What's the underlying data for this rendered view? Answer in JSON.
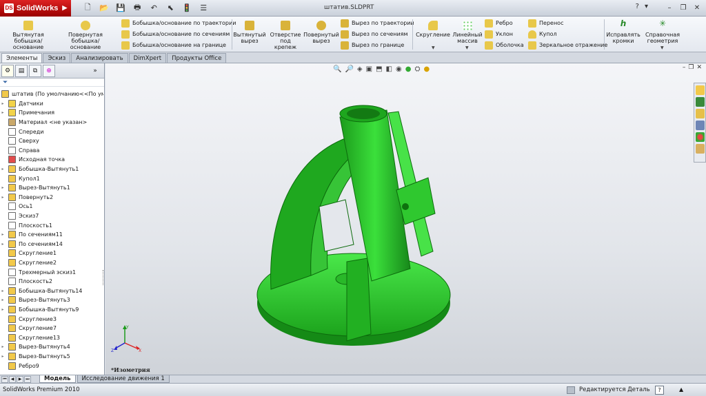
{
  "app": {
    "logo": "SolidWorks",
    "document_title": "штатив.SLDPRT",
    "quick": [
      {
        "name": "new-icon",
        "glyph": "🗋"
      },
      {
        "name": "open-icon",
        "glyph": "📂"
      },
      {
        "name": "save-icon",
        "glyph": "💾"
      },
      {
        "name": "print-icon",
        "glyph": "🖶"
      },
      {
        "name": "undo-icon",
        "glyph": "↶"
      },
      {
        "name": "select-icon",
        "glyph": "⬉"
      },
      {
        "name": "rebuild-icon",
        "glyph": "🚦"
      },
      {
        "name": "options-icon",
        "glyph": "☰"
      }
    ]
  },
  "commands": {
    "extruded_boss": "Вытянутая бобышка/основание",
    "revolved_boss": "Повернутая бобышка/основание",
    "swept_boss": "Бобышка/основание по траектории",
    "lofted_boss": "Бобышка/основание по сечениям",
    "boundary_boss": "Бобышка/основание на границе",
    "extruded_cut": "Вытянутый вырез",
    "hole_wizard": "Отверстие под крепеж",
    "revolved_cut": "Повернутый вырез",
    "swept_cut": "Вырез по траектории",
    "lofted_cut": "Вырез по сечениям",
    "boundary_cut": "Вырез по границе",
    "fillet": "Скругление",
    "linear_pattern": "Линейный массив",
    "rib": "Ребро",
    "draft": "Уклон",
    "shell": "Оболочка",
    "wrap": "Перенос",
    "dome": "Купол",
    "mirror": "Зеркальное отражение",
    "instant3d": "Исправлять кромки",
    "ref_geometry": "Справочная геометрия"
  },
  "cmd_tabs": [
    "Элементы",
    "Эскиз",
    "Анализировать",
    "DimXpert",
    "Продукты Office"
  ],
  "active_cmd_tab": "Элементы",
  "feature_tree": {
    "root": "штатив  (По умолчанию<<По ум",
    "items": [
      {
        "label": "Датчики",
        "color": "#f2d34a",
        "exp": true
      },
      {
        "label": "Примечания",
        "color": "#f2d34a",
        "exp": true
      },
      {
        "label": "Материал <не указан>",
        "color": "#c9a86a",
        "exp": false
      },
      {
        "label": "Спереди",
        "color": "#ffffff",
        "exp": false
      },
      {
        "label": "Сверху",
        "color": "#ffffff",
        "exp": false
      },
      {
        "label": "Справа",
        "color": "#ffffff",
        "exp": false
      },
      {
        "label": "Исходная точка",
        "color": "#e24c4c",
        "exp": false
      },
      {
        "label": "Бобышка-Вытянуть1",
        "color": "#f2c94a",
        "exp": true
      },
      {
        "label": "Купол1",
        "color": "#f2c94a",
        "exp": false
      },
      {
        "label": "Вырез-Вытянуть1",
        "color": "#f2c94a",
        "exp": true
      },
      {
        "label": "Повернуть2",
        "color": "#f2c94a",
        "exp": true
      },
      {
        "label": "Ось1",
        "color": "#ffffff",
        "exp": false
      },
      {
        "label": "Эскиз7",
        "color": "#ffffff",
        "exp": false
      },
      {
        "label": "Плоскость1",
        "color": "#ffffff",
        "exp": false
      },
      {
        "label": "По сечениям11",
        "color": "#f2c94a",
        "exp": true
      },
      {
        "label": "По сечениям14",
        "color": "#f2c94a",
        "exp": true
      },
      {
        "label": "Скругление1",
        "color": "#f2c94a",
        "exp": false
      },
      {
        "label": "Скругление2",
        "color": "#f2c94a",
        "exp": false
      },
      {
        "label": "Трехмерный эскиз1",
        "color": "#ffffff",
        "exp": false
      },
      {
        "label": "Плоскость2",
        "color": "#ffffff",
        "exp": false
      },
      {
        "label": "Бобышка-Вытянуть14",
        "color": "#f2c94a",
        "exp": true
      },
      {
        "label": "Вырез-Вытянуть3",
        "color": "#f2c94a",
        "exp": true
      },
      {
        "label": "Бобышка-Вытянуть9",
        "color": "#f2c94a",
        "exp": true
      },
      {
        "label": "Скругление3",
        "color": "#f2c94a",
        "exp": false
      },
      {
        "label": "Скругление7",
        "color": "#f2c94a",
        "exp": false
      },
      {
        "label": "Скругление13",
        "color": "#f2c94a",
        "exp": false
      },
      {
        "label": "Вырез-Вытянуть4",
        "color": "#f2c94a",
        "exp": true
      },
      {
        "label": "Вырез-Вытянуть5",
        "color": "#f2c94a",
        "exp": true
      },
      {
        "label": "Ребро9",
        "color": "#f2c94a",
        "exp": false
      }
    ]
  },
  "view_name": "*Изометрия",
  "bottom_tabs": [
    "Модель",
    "Исследование движения 1"
  ],
  "status": {
    "left": "SolidWorks Premium 2010",
    "mode": "Редактируется Деталь"
  },
  "model_color": "#2ed42e"
}
